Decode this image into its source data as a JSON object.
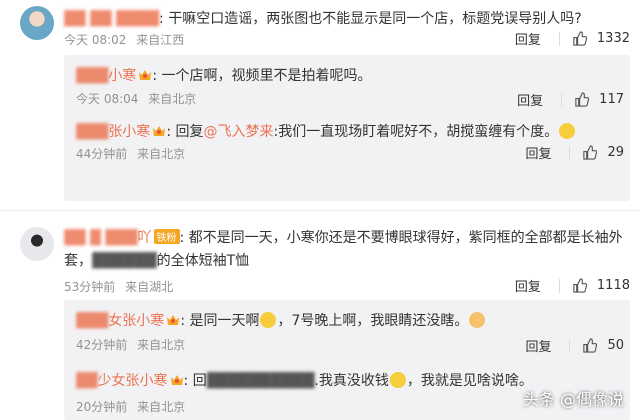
{
  "comments": [
    {
      "username_visible": "",
      "text": ": 干嘛空口造谣，两张图也不能显示是同一个店，标题党误导别人吗?",
      "time": "今天 08:02",
      "source": "来自江西",
      "reply_label": "回复",
      "likes": "1332",
      "replies": [
        {
          "username_visible": "小寒",
          "text": ": 一个店啊，视频里不是拍着呢吗。",
          "time": "今天 08:04",
          "source": "来自北京",
          "reply_label": "回复",
          "likes": "117"
        },
        {
          "username_visible": "张小寒",
          "reply_prefix": ": 回复",
          "mention": "@飞入梦来",
          "text": ":我们一直现场盯着呢好不，胡搅蛮缠有个度。",
          "time": "44分钟前",
          "source": "来自北京",
          "reply_label": "回复",
          "likes": "29"
        }
      ]
    },
    {
      "username_visible": "吖",
      "fans_badge": "铁粉",
      "text": ": 都不是同一天，小寒你还是不要博眼球得好，紫同框的全部都是长袖外",
      "text_line2": "套，",
      "text_line2_tail": "的全体短袖T恤",
      "time": "53分钟前",
      "source": "来自湖北",
      "reply_label": "回复",
      "likes": "1118",
      "replies": [
        {
          "username_visible": "女张小寒",
          "text": ": 是同一天啊",
          "text_tail": "，7号晚上啊，我眼睛还没瞎。",
          "time": "42分钟前",
          "source": "来自北京",
          "reply_label": "回复",
          "likes": "50"
        },
        {
          "username_visible": "少女张小寒",
          "reply_prefix": ": 回",
          "text": ".我真没收钱",
          "text_tail": "，我就是见啥说啥。",
          "time": "20分钟前",
          "source": "来自北京",
          "reply_label": "回复",
          "likes": ""
        }
      ]
    }
  ],
  "watermark": "头条 @偶像说",
  "colors": {
    "username": "#eb7350",
    "meta": "#939393",
    "reply_bg": "#f2f2f5",
    "badge": "#f5a623"
  },
  "icons": {
    "like": "thumbs-up-icon",
    "crown": "crown-badge-icon",
    "emoji": "emoji-icon"
  }
}
